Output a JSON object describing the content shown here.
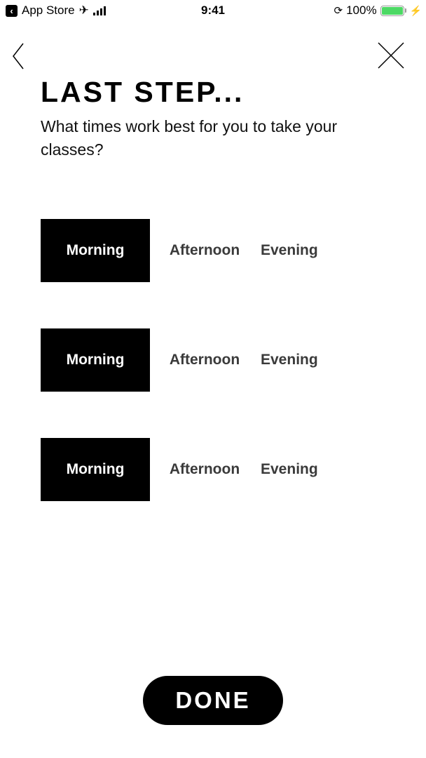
{
  "status_bar": {
    "back_app_label": "App Store",
    "time": "9:41",
    "battery_percent": "100%",
    "battery_level": 1.0,
    "battery_color": "#4cd964"
  },
  "nav": {
    "back_icon": "chevron-left-icon",
    "close_icon": "close-icon"
  },
  "header": {
    "title": "LAST STEP...",
    "subtitle": "What times work best for you to take your classes?"
  },
  "time_rows": [
    {
      "options": [
        "Morning",
        "Afternoon",
        "Evening"
      ],
      "selected": "Morning"
    },
    {
      "options": [
        "Morning",
        "Afternoon",
        "Evening"
      ],
      "selected": "Morning"
    },
    {
      "options": [
        "Morning",
        "Afternoon",
        "Evening"
      ],
      "selected": "Morning"
    }
  ],
  "done_button": {
    "label": "DONE"
  }
}
